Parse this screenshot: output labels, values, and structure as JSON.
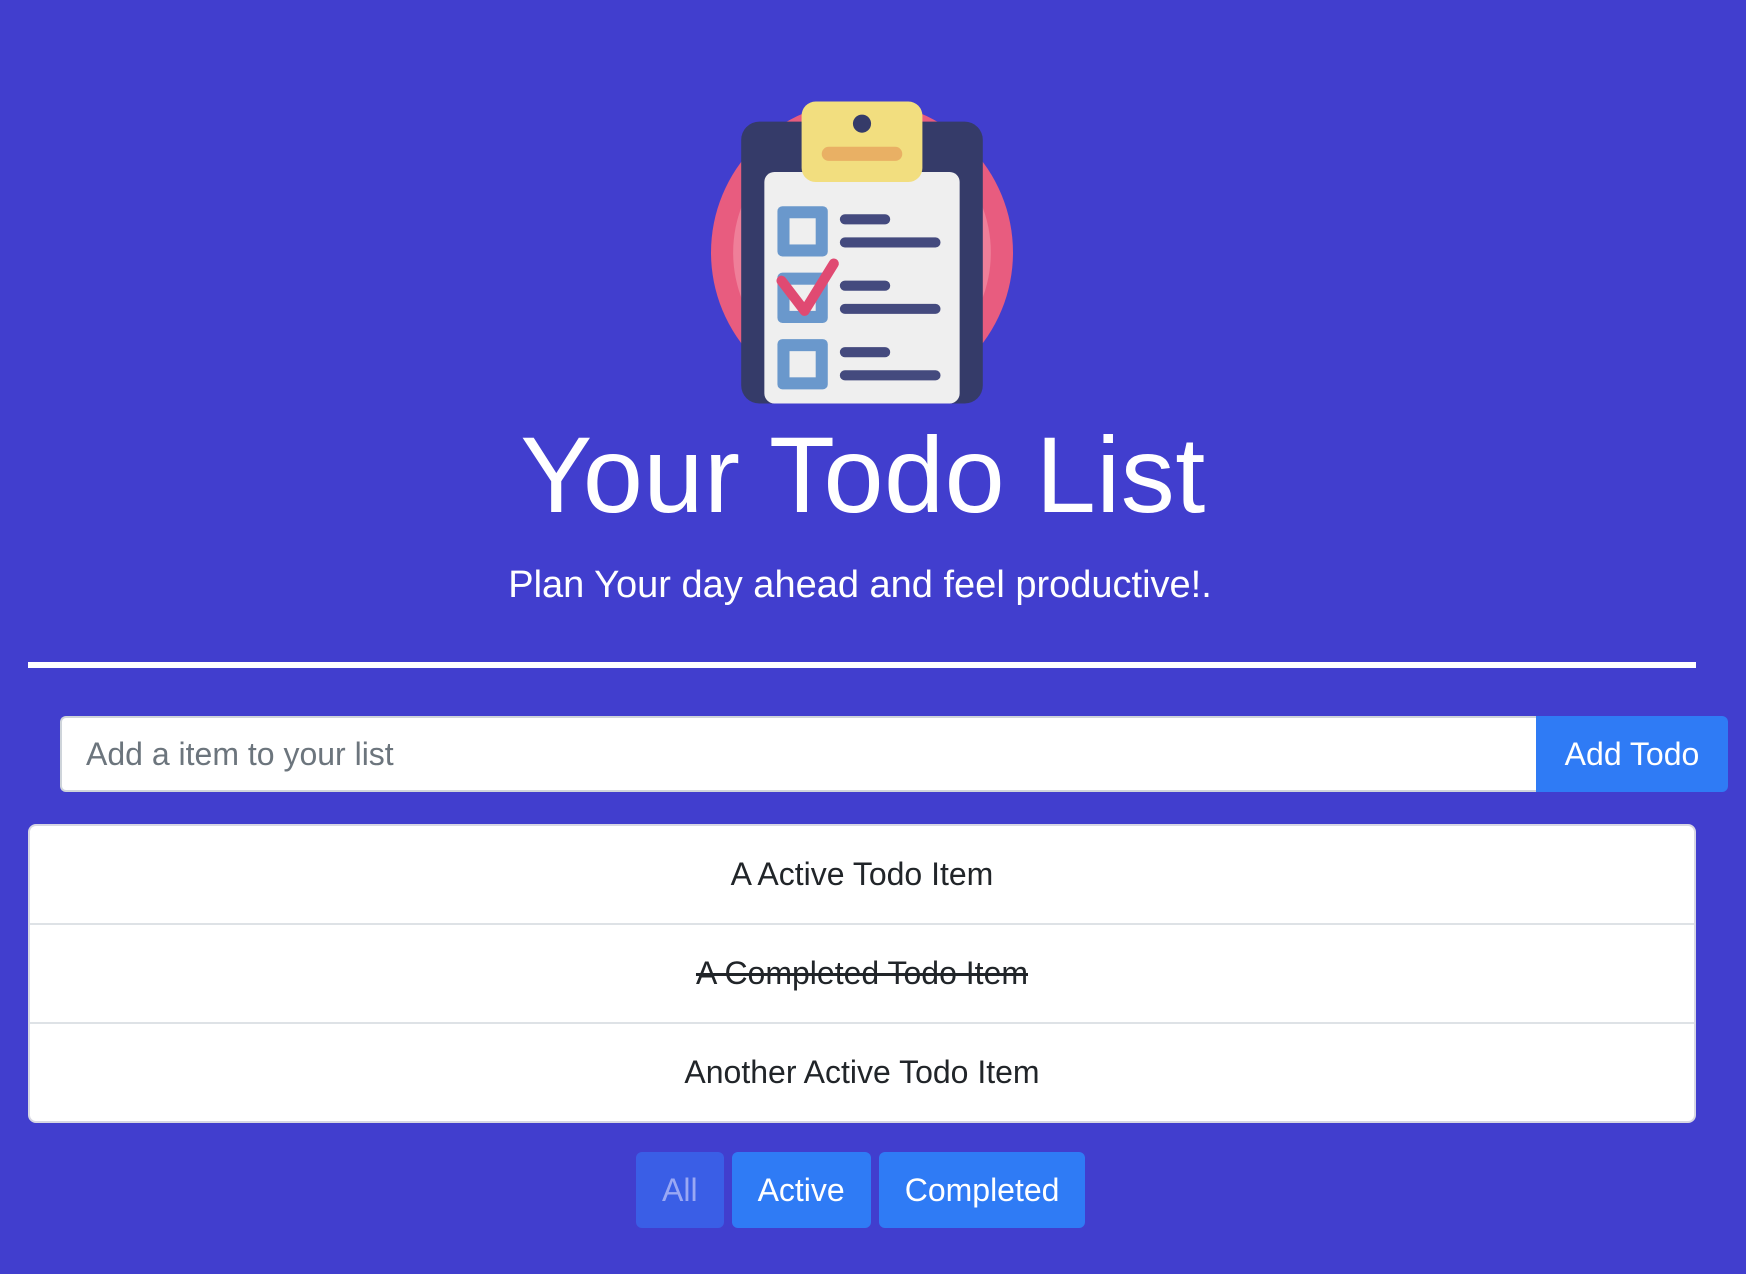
{
  "header": {
    "logo_icon": "todo-clipboard-icon",
    "title": "Your Todo List",
    "subtitle": "Plan Your day ahead and feel productive!."
  },
  "form": {
    "input_value": "",
    "input_placeholder": "Add a item to your list",
    "add_button_label": "Add Todo"
  },
  "todos": [
    {
      "text": "A Active Todo Item",
      "completed": false
    },
    {
      "text": "A Completed Todo Item",
      "completed": true
    },
    {
      "text": "Another Active Todo Item",
      "completed": false
    }
  ],
  "filters": {
    "all_label": "All",
    "active_label": "Active",
    "completed_label": "Completed",
    "selected": "All"
  },
  "colors": {
    "background": "#413ece",
    "button": "#2f7bf5",
    "selected_button": "#3a5ee6"
  }
}
